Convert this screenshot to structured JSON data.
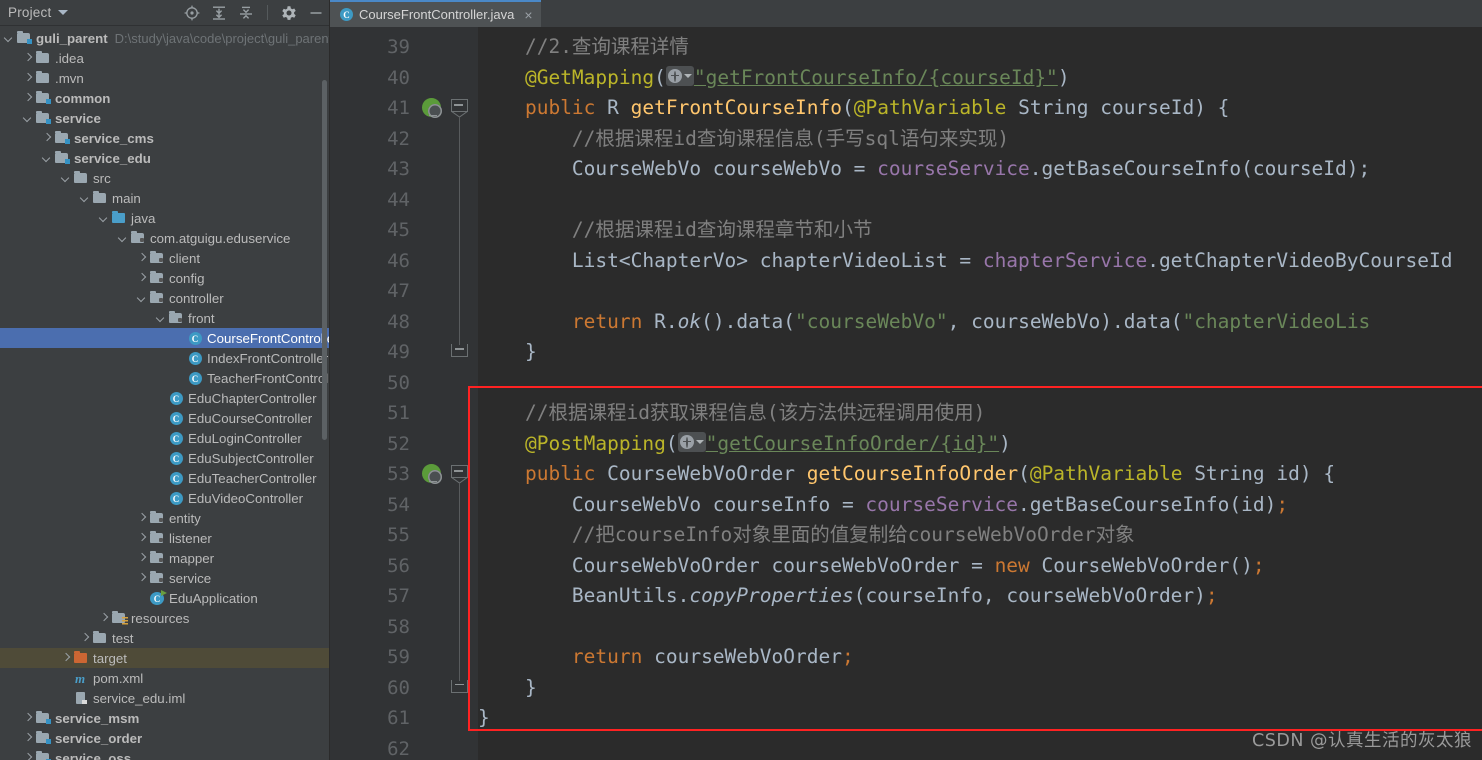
{
  "panel": {
    "title": "Project",
    "tools": [
      {
        "name": "locate-icon",
        "label": "Select Opened File"
      },
      {
        "name": "expand-all-icon",
        "label": "Expand All"
      },
      {
        "name": "collapse-all-icon",
        "label": "Collapse All"
      },
      {
        "name": "settings-gear-icon",
        "label": "Settings"
      },
      {
        "name": "hide-icon",
        "label": "Hide"
      }
    ],
    "tree": [
      {
        "depth": 0,
        "arrow": "d",
        "icon": "module",
        "label": "guli_parent",
        "bold": true,
        "path": "D:\\study\\java\\code\\project\\guli_parent"
      },
      {
        "depth": 1,
        "arrow": "r",
        "icon": "folder",
        "label": ".idea"
      },
      {
        "depth": 1,
        "arrow": "r",
        "icon": "folder",
        "label": ".mvn"
      },
      {
        "depth": 1,
        "arrow": "r",
        "icon": "module",
        "label": "common",
        "bold": true
      },
      {
        "depth": 1,
        "arrow": "d",
        "icon": "module",
        "label": "service",
        "bold": true
      },
      {
        "depth": 2,
        "arrow": "r",
        "icon": "module",
        "label": "service_cms",
        "bold": true
      },
      {
        "depth": 2,
        "arrow": "d",
        "icon": "module",
        "label": "service_edu",
        "bold": true
      },
      {
        "depth": 3,
        "arrow": "d",
        "icon": "folder",
        "label": "src"
      },
      {
        "depth": 4,
        "arrow": "d",
        "icon": "folder",
        "label": "main"
      },
      {
        "depth": 5,
        "arrow": "d",
        "icon": "source",
        "label": "java"
      },
      {
        "depth": 6,
        "arrow": "d",
        "icon": "package",
        "label": "com.atguigu.eduservice"
      },
      {
        "depth": 7,
        "arrow": "r",
        "icon": "package",
        "label": "client"
      },
      {
        "depth": 7,
        "arrow": "r",
        "icon": "package",
        "label": "config"
      },
      {
        "depth": 7,
        "arrow": "d",
        "icon": "package",
        "label": "controller"
      },
      {
        "depth": 8,
        "arrow": "d",
        "icon": "package",
        "label": "front"
      },
      {
        "depth": 9,
        "arrow": "none",
        "icon": "class",
        "label": "CourseFrontController",
        "selected": true
      },
      {
        "depth": 9,
        "arrow": "none",
        "icon": "class",
        "label": "IndexFrontController"
      },
      {
        "depth": 9,
        "arrow": "none",
        "icon": "class",
        "label": "TeacherFrontController"
      },
      {
        "depth": 8,
        "arrow": "none",
        "icon": "class",
        "label": "EduChapterController"
      },
      {
        "depth": 8,
        "arrow": "none",
        "icon": "class",
        "label": "EduCourseController"
      },
      {
        "depth": 8,
        "arrow": "none",
        "icon": "class",
        "label": "EduLoginController"
      },
      {
        "depth": 8,
        "arrow": "none",
        "icon": "class",
        "label": "EduSubjectController"
      },
      {
        "depth": 8,
        "arrow": "none",
        "icon": "class",
        "label": "EduTeacherController"
      },
      {
        "depth": 8,
        "arrow": "none",
        "icon": "class",
        "label": "EduVideoController"
      },
      {
        "depth": 7,
        "arrow": "r",
        "icon": "package",
        "label": "entity"
      },
      {
        "depth": 7,
        "arrow": "r",
        "icon": "package",
        "label": "listener"
      },
      {
        "depth": 7,
        "arrow": "r",
        "icon": "package",
        "label": "mapper"
      },
      {
        "depth": 7,
        "arrow": "r",
        "icon": "package",
        "label": "service"
      },
      {
        "depth": 7,
        "arrow": "none",
        "icon": "spring",
        "label": "EduApplication"
      },
      {
        "depth": 5,
        "arrow": "r",
        "icon": "resources",
        "label": "resources"
      },
      {
        "depth": 4,
        "arrow": "r",
        "icon": "folder",
        "label": "test"
      },
      {
        "depth": 3,
        "arrow": "r",
        "icon": "target",
        "label": "target",
        "highlighted": true
      },
      {
        "depth": 3,
        "arrow": "none",
        "icon": "maven",
        "label": "pom.xml"
      },
      {
        "depth": 3,
        "arrow": "none",
        "icon": "iml",
        "label": "service_edu.iml"
      },
      {
        "depth": 1,
        "arrow": "r",
        "icon": "module",
        "label": "service_msm",
        "bold": true
      },
      {
        "depth": 1,
        "arrow": "r",
        "icon": "module",
        "label": "service_order",
        "bold": true
      },
      {
        "depth": 1,
        "arrow": "r",
        "icon": "module",
        "label": "service_oss",
        "bold": true
      }
    ]
  },
  "editor": {
    "tab": {
      "label": "CourseFrontController.java",
      "icon": "java-class-icon",
      "close": "×"
    },
    "first_line_number": 39,
    "lines": [
      {
        "n": 39,
        "tokens": [
          {
            "t": "    ",
            "c": "id"
          },
          {
            "t": "//2.查询课程详情",
            "c": "cm"
          }
        ]
      },
      {
        "n": 40,
        "tokens": [
          {
            "t": "    ",
            "c": "id"
          },
          {
            "t": "@GetMapping",
            "c": "anno"
          },
          {
            "t": "(",
            "c": "id"
          },
          {
            "t": "@@CHIP@@",
            "c": "chip"
          },
          {
            "t": "\"getFrontCourseInfo/{courseId}\"",
            "c": "str ul"
          },
          {
            "t": ")",
            "c": "id"
          }
        ]
      },
      {
        "n": 41,
        "gutterIcon": "spring-mapping-globe",
        "fold": "start",
        "tokens": [
          {
            "t": "    ",
            "c": "id"
          },
          {
            "t": "public",
            "c": "kw"
          },
          {
            "t": " R ",
            "c": "id"
          },
          {
            "t": "getFrontCourseInfo",
            "c": "mth"
          },
          {
            "t": "(",
            "c": "id"
          },
          {
            "t": "@PathVariable",
            "c": "anno"
          },
          {
            "t": " String courseId) {",
            "c": "id"
          }
        ]
      },
      {
        "n": 42,
        "tokens": [
          {
            "t": "        ",
            "c": "id"
          },
          {
            "t": "//根据课程id查询课程信息(手写sql语句来实现)",
            "c": "cm"
          }
        ]
      },
      {
        "n": 43,
        "tokens": [
          {
            "t": "        CourseWebVo courseWebVo = ",
            "c": "id"
          },
          {
            "t": "courseService",
            "c": "fld"
          },
          {
            "t": ".getBaseCourseInfo(courseId);",
            "c": "id"
          }
        ]
      },
      {
        "n": 44,
        "tokens": []
      },
      {
        "n": 45,
        "tokens": [
          {
            "t": "        ",
            "c": "id"
          },
          {
            "t": "//根据课程id查询课程章节和小节",
            "c": "cm"
          }
        ]
      },
      {
        "n": 46,
        "tokens": [
          {
            "t": "        List<ChapterVo> chapterVideoList = ",
            "c": "id"
          },
          {
            "t": "chapterService",
            "c": "fld"
          },
          {
            "t": ".getChapterVideoByCourseId",
            "c": "id"
          }
        ]
      },
      {
        "n": 47,
        "tokens": []
      },
      {
        "n": 48,
        "tokens": [
          {
            "t": "        ",
            "c": "id"
          },
          {
            "t": "return",
            "c": "kw"
          },
          {
            "t": " R.",
            "c": "id"
          },
          {
            "t": "ok",
            "c": "it"
          },
          {
            "t": "().data(",
            "c": "id"
          },
          {
            "t": "\"courseWebVo\"",
            "c": "str"
          },
          {
            "t": ", courseWebVo).data(",
            "c": "id"
          },
          {
            "t": "\"chapterVideoLis",
            "c": "str"
          }
        ]
      },
      {
        "n": 49,
        "fold": "end",
        "tokens": [
          {
            "t": "    }",
            "c": "id"
          }
        ]
      },
      {
        "n": 50,
        "tokens": []
      },
      {
        "n": 51,
        "tokens": [
          {
            "t": "    ",
            "c": "id"
          },
          {
            "t": "//根据课程id获取课程信息(该方法供远程调用使用)",
            "c": "cm"
          }
        ]
      },
      {
        "n": 52,
        "tokens": [
          {
            "t": "    ",
            "c": "id"
          },
          {
            "t": "@PostMapping",
            "c": "anno"
          },
          {
            "t": "(",
            "c": "id"
          },
          {
            "t": "@@CHIP@@",
            "c": "chip"
          },
          {
            "t": "\"getCourseInfoOrder/{id}\"",
            "c": "str ul"
          },
          {
            "t": ")",
            "c": "id"
          }
        ]
      },
      {
        "n": 53,
        "gutterIcon": "spring-mapping-globe",
        "fold": "start",
        "tokens": [
          {
            "t": "    ",
            "c": "id"
          },
          {
            "t": "public",
            "c": "kw"
          },
          {
            "t": " CourseWebVoOrder ",
            "c": "id"
          },
          {
            "t": "getCourseInfoOrder",
            "c": "mth"
          },
          {
            "t": "(",
            "c": "id"
          },
          {
            "t": "@PathVariable",
            "c": "anno"
          },
          {
            "t": " String id) {",
            "c": "id"
          }
        ]
      },
      {
        "n": 54,
        "tokens": [
          {
            "t": "        CourseWebVo courseInfo = ",
            "c": "id"
          },
          {
            "t": "courseService",
            "c": "fld"
          },
          {
            "t": ".getBaseCourseInfo(id)",
            "c": "id"
          },
          {
            "t": ";",
            "c": "kw"
          }
        ]
      },
      {
        "n": 55,
        "tokens": [
          {
            "t": "        ",
            "c": "id"
          },
          {
            "t": "//把courseInfo对象里面的值复制给courseWebVoOrder对象",
            "c": "cm"
          }
        ]
      },
      {
        "n": 56,
        "tokens": [
          {
            "t": "        CourseWebVoOrder courseWebVoOrder = ",
            "c": "id"
          },
          {
            "t": "new",
            "c": "kw"
          },
          {
            "t": " CourseWebVoOrder()",
            "c": "id"
          },
          {
            "t": ";",
            "c": "kw"
          }
        ]
      },
      {
        "n": 57,
        "tokens": [
          {
            "t": "        BeanUtils.",
            "c": "id"
          },
          {
            "t": "copyProperties",
            "c": "it"
          },
          {
            "t": "(courseInfo, courseWebVoOrder)",
            "c": "id"
          },
          {
            "t": ";",
            "c": "kw"
          }
        ]
      },
      {
        "n": 58,
        "tokens": []
      },
      {
        "n": 59,
        "tokens": [
          {
            "t": "        ",
            "c": "id"
          },
          {
            "t": "return",
            "c": "kw"
          },
          {
            "t": " courseWebVoOrder",
            "c": "id"
          },
          {
            "t": ";",
            "c": "kw"
          }
        ]
      },
      {
        "n": 60,
        "fold": "end",
        "tokens": [
          {
            "t": "    }",
            "c": "id"
          }
        ]
      },
      {
        "n": 61,
        "tokens": [
          {
            "t": "}",
            "c": "id"
          }
        ]
      },
      {
        "n": 62,
        "tokens": []
      }
    ],
    "highlight_box": {
      "label": "red-annotation-box",
      "color": "#ff2222",
      "from_line": 50,
      "to_line": 61
    }
  },
  "watermark": "CSDN @认真生活的灰太狼",
  "colors": {
    "selection": "#4b6eaf",
    "highlight_row": "#4f4b38",
    "editor_bg": "#2b2b2b",
    "panel_bg": "#3c3f41",
    "gutter_bg": "#313335",
    "accent_red": "#ff2222"
  }
}
